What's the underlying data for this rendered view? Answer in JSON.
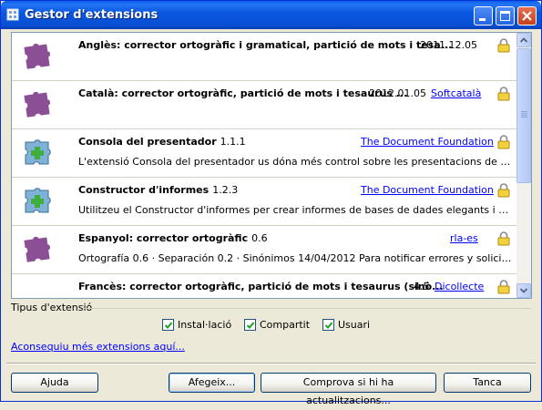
{
  "window": {
    "title": "Gestor d'extensions"
  },
  "extensions": [
    {
      "name": "Anglès: corrector ortogràfic i gramatical, partició de mots i tesa...",
      "version": "",
      "date": "2011.12.05",
      "publisher": "",
      "description": "",
      "icon": "puzzle-icon"
    },
    {
      "name": "Català: corrector ortogràfic, partició de mots i tesaurus ...",
      "version": "",
      "date": "2012.01.05",
      "publisher": "Softcatalà",
      "description": "",
      "icon": "puzzle-icon"
    },
    {
      "name": "Consola del presentador",
      "version": "1.1.1",
      "date": "",
      "publisher": "The Document Foundation",
      "description": "L'extensió Consola del presentador us dóna més control sobre les presentacions de diapositives, c...",
      "icon": "puzzle-plus-icon"
    },
    {
      "name": "Constructor d'informes",
      "version": "1.2.3",
      "date": "",
      "publisher": "The Document Foundation",
      "description": "Utilitzeu el Constructor d'informes per crear informes de bases de dades elegants i amb estil. El fle...",
      "icon": "puzzle-plus-icon"
    },
    {
      "name": "Espanyol: corrector ortogràfic",
      "version": "0.6",
      "date": "",
      "publisher": "rla-es",
      "description": "Ortografía 0.6 · Separación 0.2 · Sinónimos 14/04/2012   Para notificar errores y solicitar la inclusi...",
      "icon": "puzzle-icon"
    },
    {
      "name": "Francès: corrector ortogràfic, partició de mots i tesaurus (sinò...",
      "version": "4.5",
      "date": "",
      "publisher": "Dicollecte",
      "description": "",
      "icon": "fr-icon"
    }
  ],
  "filter": {
    "label": "Tipus d'extensió",
    "installation": "Instal·lació",
    "shared": "Compartit",
    "user": "Usuari"
  },
  "more_link": "Aconsequiu més extensions aquí...",
  "buttons": {
    "help": "Ajuda",
    "add": "Afegeix...",
    "check_updates": "Comprova si hi ha actualitzacions...",
    "close": "Tanca"
  }
}
